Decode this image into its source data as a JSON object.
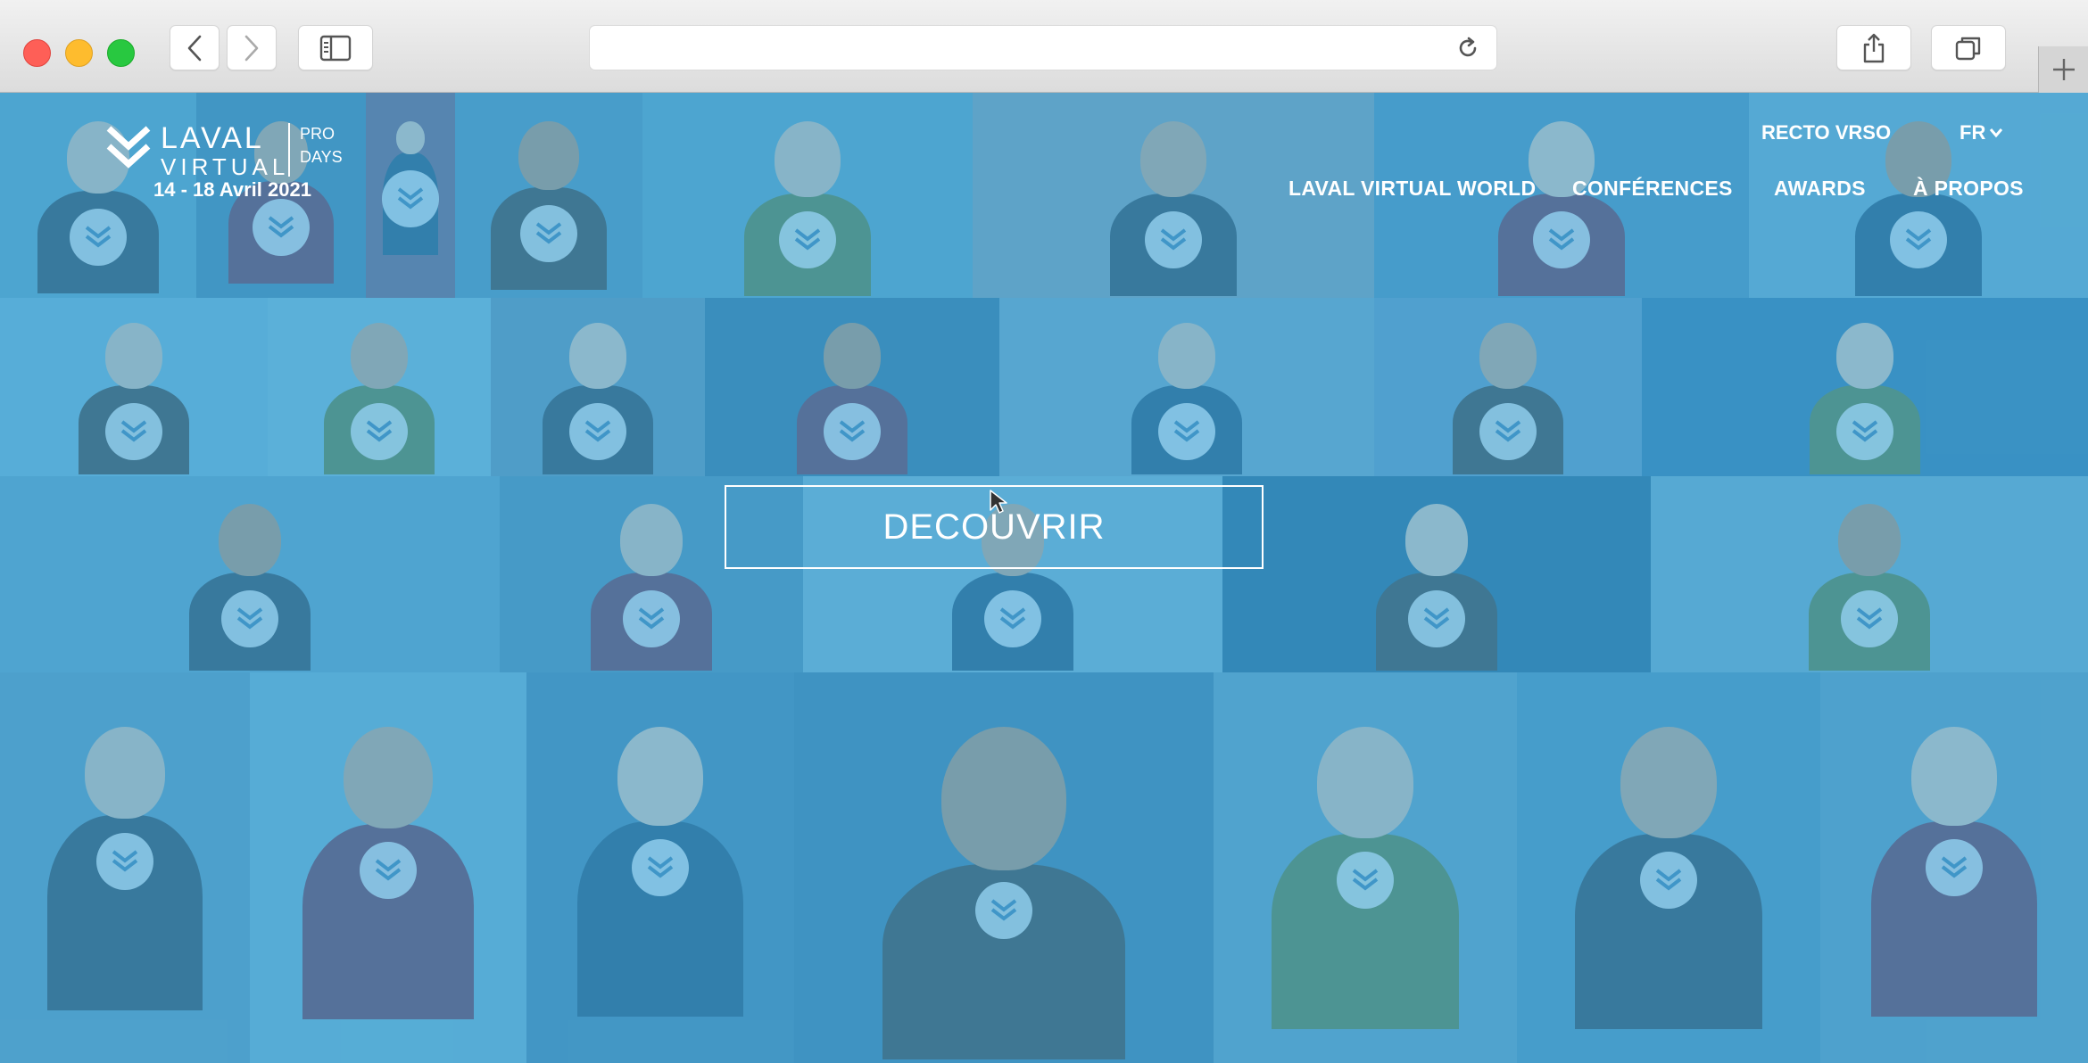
{
  "browser": {
    "address": "",
    "icons": {
      "back": "chevron-left-icon",
      "forward": "chevron-right-icon",
      "sidebar": "sidebar-icon",
      "reload": "reload-icon",
      "share": "share-icon",
      "tabs": "tabs-overview-icon",
      "new_tab": "plus-icon"
    }
  },
  "site": {
    "logo": {
      "laval": "LAVAL",
      "virtual": "VIRTUAL",
      "pro": "PRO",
      "days": "DAYS"
    },
    "dates": "14 - 18 Avril 2021",
    "recto": "RECTO VRSO",
    "lang": "FR",
    "nav": [
      {
        "label": "LAVAL VIRTUAL WORLD"
      },
      {
        "label": "CONFÉRENCES"
      },
      {
        "label": "AWARDS"
      },
      {
        "label": "À PROPOS"
      }
    ],
    "cta": "DECOUVRIR"
  },
  "colors": {
    "overlay": "#44aadc",
    "text": "#ffffff",
    "mac_red": "#fe5f57",
    "mac_yellow": "#febc2e",
    "mac_green": "#28c840"
  }
}
